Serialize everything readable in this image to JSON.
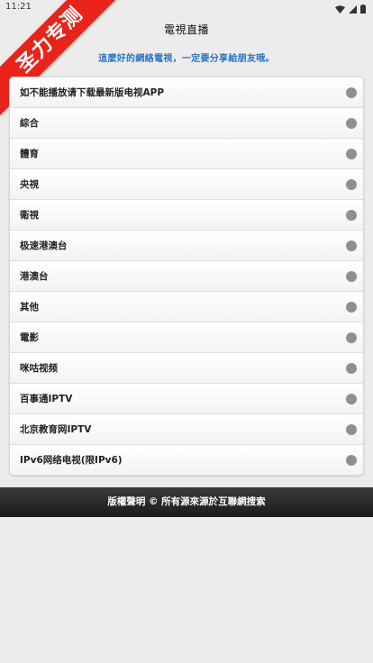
{
  "status_bar": {
    "time": "11:21"
  },
  "header": {
    "title": "電視直播"
  },
  "ribbon": {
    "text": "圣力专测",
    "color": "#e8231a"
  },
  "notice": "這麼好的網絡電視，一定要分享給朋友哦。",
  "channels": [
    {
      "label": "如不能播放请下载最新版电视APP"
    },
    {
      "label": "綜合"
    },
    {
      "label": "體育"
    },
    {
      "label": "央視"
    },
    {
      "label": "衛視"
    },
    {
      "label": "极速港澳台"
    },
    {
      "label": "港澳台"
    },
    {
      "label": "其他"
    },
    {
      "label": "電影"
    },
    {
      "label": "咪咕视频"
    },
    {
      "label": "百事通IPTV"
    },
    {
      "label": "北京教育网IPTV"
    },
    {
      "label": "IPv6网络电视(限IPv6)"
    }
  ],
  "footer": {
    "text": "版權聲明 © 所有源來源於互聯網搜索"
  },
  "colors": {
    "notice": "#2a73c2",
    "dot": "#8f8f8f",
    "footer_bg": "#1b1b1b"
  },
  "icons": {
    "wifi": "wifi-icon",
    "signal": "signal-icon",
    "battery": "battery-icon",
    "dot": "circle-icon"
  }
}
